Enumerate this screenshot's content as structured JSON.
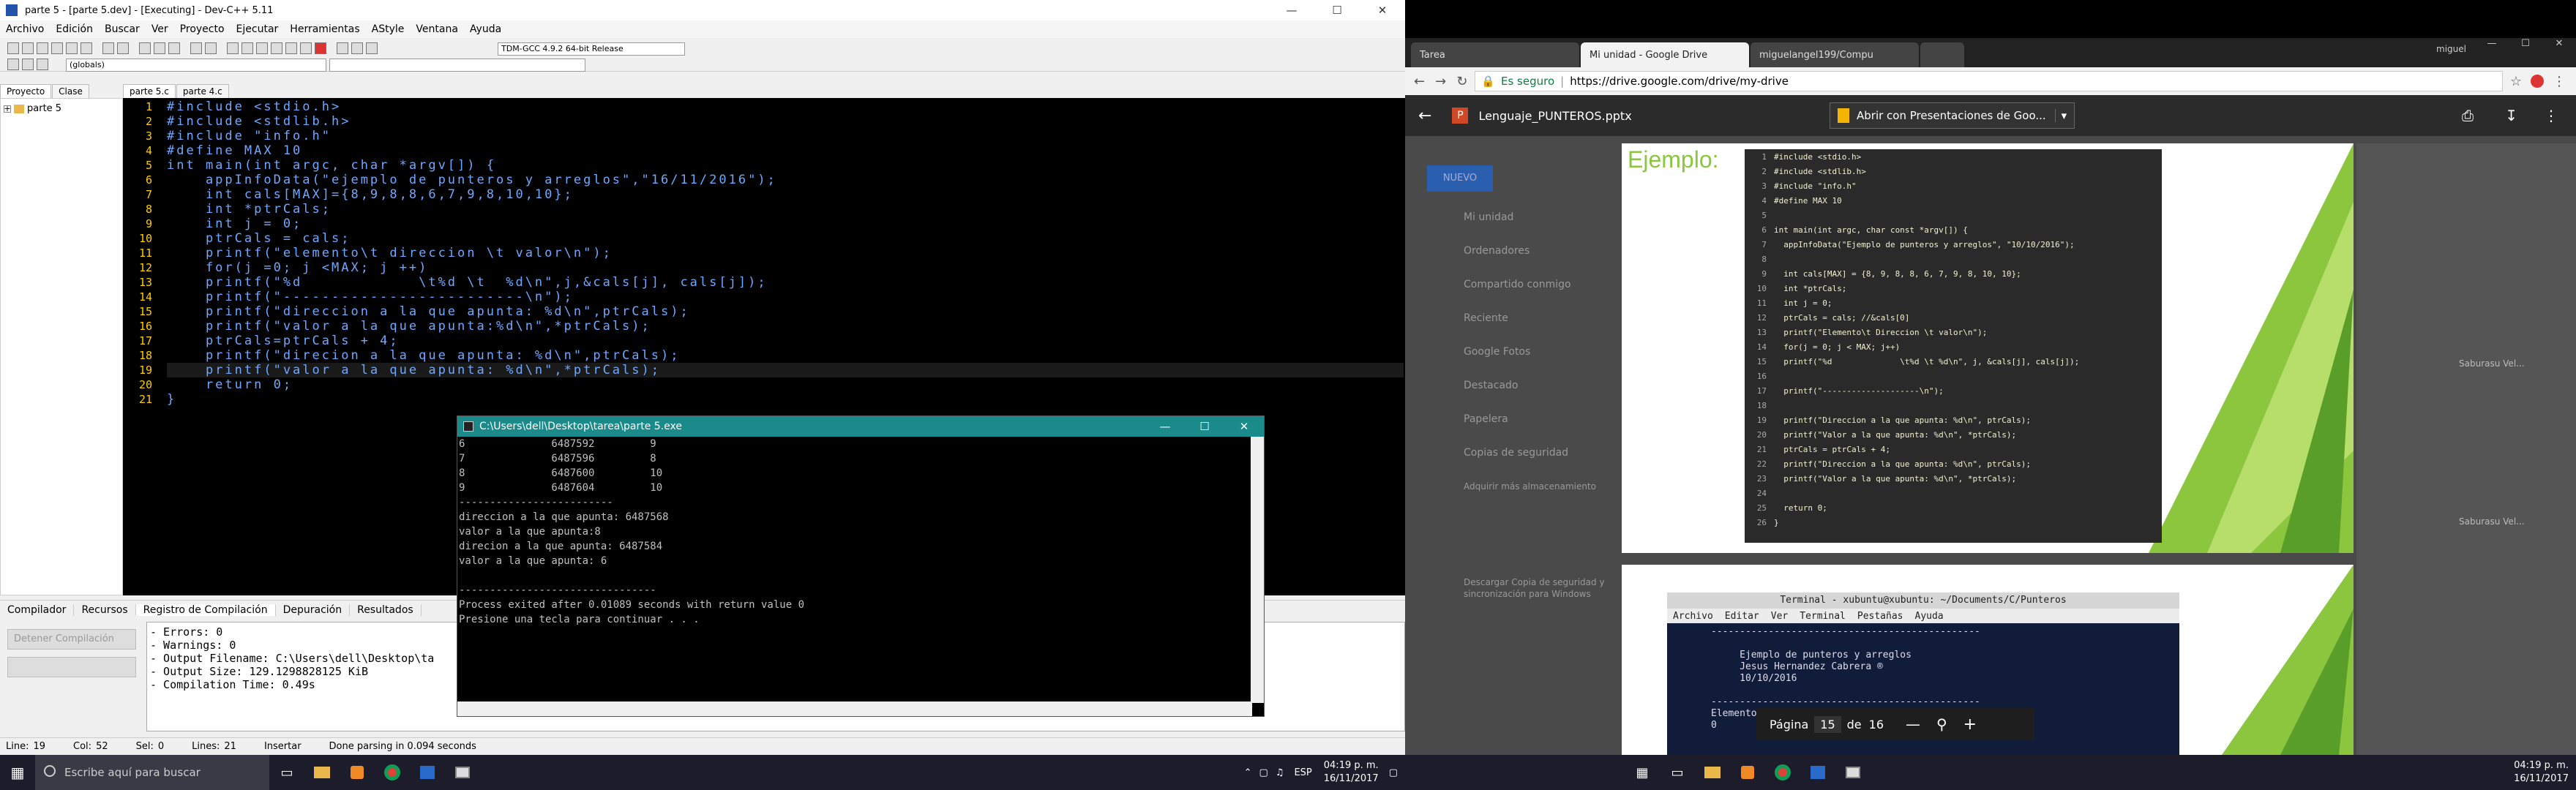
{
  "devcpp": {
    "title": "parte 5 - [parte 5.dev] - [Executing] - Dev-C++ 5.11",
    "menu": [
      "Archivo",
      "Edición",
      "Buscar",
      "Ver",
      "Proyecto",
      "Ejecutar",
      "Herramientas",
      "AStyle",
      "Ventana",
      "Ayuda"
    ],
    "compiler_select": "TDM-GCC 4.9.2 64-bit Release",
    "scope_select": "(globals)",
    "left_tabs": [
      "Proyecto",
      "Clase"
    ],
    "file_tabs": [
      "parte 5.c",
      "parte 4.c"
    ],
    "project_item": "parte 5",
    "code_lines": [
      {
        "n": "1",
        "t": "#include <stdio.h>"
      },
      {
        "n": "2",
        "t": "#include <stdlib.h>"
      },
      {
        "n": "3",
        "t": "#include \"info.h\""
      },
      {
        "n": "4",
        "t": "#define MAX 10"
      },
      {
        "n": "5",
        "t": "int main(int argc, char *argv[]) {"
      },
      {
        "n": "6",
        "t": "    appInfoData(\"ejemplo de punteros y arreglos\",\"16/11/2016\");"
      },
      {
        "n": "7",
        "t": "    int cals[MAX]={8,9,8,8,6,7,9,8,10,10};"
      },
      {
        "n": "8",
        "t": "    int *ptrCals;"
      },
      {
        "n": "9",
        "t": "    int j = 0;"
      },
      {
        "n": "10",
        "t": "    ptrCals = cals;"
      },
      {
        "n": "11",
        "t": "    printf(\"elemento\\t direccion \\t valor\\n\");"
      },
      {
        "n": "12",
        "t": "    for(j =0; j <MAX; j ++)"
      },
      {
        "n": "13",
        "t": "    printf(\"%d            \\t%d \\t  %d\\n\",j,&cals[j], cals[j]);"
      },
      {
        "n": "14",
        "t": "    printf(\"-------------------------\\n\");"
      },
      {
        "n": "15",
        "t": "    printf(\"direccion a la que apunta: %d\\n\",ptrCals);"
      },
      {
        "n": "16",
        "t": "    printf(\"valor a la que apunta:%d\\n\",*ptrCals);"
      },
      {
        "n": "17",
        "t": "    ptrCals=ptrCals + 4;"
      },
      {
        "n": "18",
        "t": "    printf(\"direcion a la que apunta: %d\\n\",ptrCals);"
      },
      {
        "n": "19",
        "t": "    printf(\"valor a la que apunta: %d\\n\",*ptrCals);"
      },
      {
        "n": "20",
        "t": "    return 0;"
      },
      {
        "n": "21",
        "t": "}"
      }
    ],
    "bottom_tabs": [
      "Compilador",
      "Recursos",
      "Registro de Compilación",
      "Depuración",
      "Resultados"
    ],
    "bottom_buttons": [
      "Detener Compilación",
      ""
    ],
    "compile_log": [
      "- Errors: 0",
      "- Warnings: 0",
      "- Output Filename: C:\\Users\\dell\\Desktop\\ta",
      "- Output Size: 129.1298828125 KiB",
      "- Compilation Time: 0.49s"
    ],
    "status": {
      "line_label": "Line:",
      "line": "19",
      "col_label": "Col:",
      "col": "52",
      "sel_label": "Sel:",
      "sel": "0",
      "lines_label": "Lines:",
      "lines": "21",
      "mode": "Insertar",
      "message": "Done parsing in 0.094 seconds"
    }
  },
  "console": {
    "title": "C:\\Users\\dell\\Desktop\\tarea\\parte 5.exe",
    "lines": [
      "6              6487592         9",
      "7              6487596         8",
      "8              6487600         10",
      "9              6487604         10",
      "-------------------------",
      "direccion a la que apunta: 6487568",
      "valor a la que apunta:8",
      "direcion a la que apunta: 6487584",
      "valor a la que apunta: 6",
      "",
      "--------------------------------",
      "Process exited after 0.01089 seconds with return value 0",
      "Presione una tecla para continuar . . ."
    ]
  },
  "taskbar1": {
    "search": "Escribe aquí para buscar",
    "lang": "ESP",
    "time": "04:19 p. m.",
    "date": "16/11/2017"
  },
  "chrome": {
    "user": "miguel",
    "tabs": [
      "Tarea",
      "Mi unidad - Google Drive",
      "miguelangel199/Compu",
      ""
    ],
    "secure_label": "Es seguro",
    "url": "https://drive.google.com/drive/my-drive",
    "file_name": "Lenguaje_PUNTEROS.pptx",
    "open_with": "Abrir con Presentaciones de Goo...",
    "slide_title": "Ejemplo:",
    "slide_code": [
      {
        "n": "1",
        "t": "#include <stdio.h>"
      },
      {
        "n": "2",
        "t": "#include <stdlib.h>"
      },
      {
        "n": "3",
        "t": "#include \"info.h\""
      },
      {
        "n": "4",
        "t": "#define MAX 10"
      },
      {
        "n": "5",
        "t": ""
      },
      {
        "n": "6",
        "t": "int main(int argc, char const *argv[]) {"
      },
      {
        "n": "7",
        "t": "  appInfoData(\"Ejemplo de punteros y arreglos\", \"10/10/2016\");"
      },
      {
        "n": "8",
        "t": ""
      },
      {
        "n": "9",
        "t": "  int cals[MAX] = {8, 9, 8, 8, 6, 7, 9, 8, 10, 10};"
      },
      {
        "n": "10",
        "t": "  int *ptrCals;"
      },
      {
        "n": "11",
        "t": "  int j = 0;"
      },
      {
        "n": "12",
        "t": "  ptrCals = cals; //&cals[0]"
      },
      {
        "n": "13",
        "t": "  printf(\"Elemento\\t Direccion \\t valor\\n\");"
      },
      {
        "n": "14",
        "t": "  for(j = 0; j < MAX; j++)"
      },
      {
        "n": "15",
        "t": "  printf(\"%d              \\t%d \\t %d\\n\", j, &cals[j], cals[j]);"
      },
      {
        "n": "16",
        "t": ""
      },
      {
        "n": "17",
        "t": "  printf(\"--------------------\\n\");"
      },
      {
        "n": "18",
        "t": ""
      },
      {
        "n": "19",
        "t": "  printf(\"Direccion a la que apunta: %d\\n\", ptrCals);"
      },
      {
        "n": "20",
        "t": "  printf(\"Valor a la que apunta: %d\\n\", *ptrCals);"
      },
      {
        "n": "21",
        "t": "  ptrCals = ptrCals + 4;"
      },
      {
        "n": "22",
        "t": "  printf(\"Direccion a la que apunta: %d\\n\", ptrCals);"
      },
      {
        "n": "23",
        "t": "  printf(\"Valor a la que apunta: %d\\n\", *ptrCals);"
      },
      {
        "n": "24",
        "t": ""
      },
      {
        "n": "25",
        "t": "  return 0;"
      },
      {
        "n": "26",
        "t": "}"
      }
    ],
    "terminal_title": "Terminal - xubuntu@xubuntu: ~/Documents/C/Punteros",
    "terminal_menu": [
      "Archivo",
      "Editar",
      "Ver",
      "Terminal",
      "Pestañas",
      "Ayuda"
    ],
    "terminal_lines": [
      "-----------------------------------------------",
      "",
      "     Ejemplo de punteros y arreglos",
      "     Jesus Hernandez Cabrera ®",
      "     10/10/2016",
      "",
      "-----------------------------------------------",
      "Elemento          Direccion",
      "0                 1578711880    8"
    ],
    "pager": {
      "label": "Página",
      "current": "15",
      "of": "de",
      "total": "16"
    },
    "drive_sidebar": [
      "Mi unidad",
      "Ordenadores",
      "Compartido conmigo",
      "Reciente",
      "Google Fotos",
      "Destacado",
      "Papelera",
      "Copias de seguridad",
      "Adquirir más almacenamiento",
      "Descargar Copia de seguridad y sincronización para Windows"
    ],
    "new_button": "NUEVO",
    "right_items": [
      "Saburasu Vel...",
      "Saburasu Vel..."
    ]
  },
  "taskbar2": {
    "time": "04:19 p. m.",
    "date": "16/11/2017"
  }
}
